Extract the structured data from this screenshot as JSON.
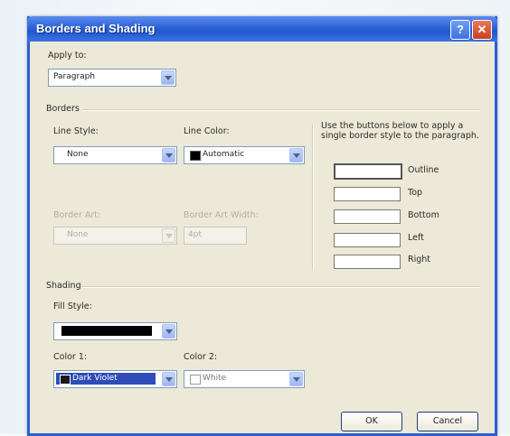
{
  "dialog": {
    "title": "Borders and Shading",
    "help_glyph": "?",
    "close_glyph": "✕"
  },
  "apply_to": {
    "label": "Apply to:",
    "value": "Paragraph"
  },
  "borders": {
    "heading": "Borders",
    "line_style_label": "Line Style:",
    "line_style_value": "None",
    "line_color_label": "Line Color:",
    "line_color_value": "Automatic",
    "border_art_label": "Border Art:",
    "border_art_value": "None",
    "border_art_width_label": "Border Art Width:",
    "border_art_width_value": "4pt",
    "instructions": "Use the buttons below to apply a single border style to the paragraph.",
    "buttons": [
      "Outline",
      "Top",
      "Bottom",
      "Left",
      "Right"
    ]
  },
  "shading": {
    "heading": "Shading",
    "fill_style_label": "Fill Style:",
    "color1_label": "Color 1:",
    "color1_value": "Dark Violet",
    "color2_label": "Color 2:",
    "color2_value": "White"
  },
  "footer": {
    "ok_label": "OK",
    "cancel_label": "Cancel"
  },
  "colors": {
    "titlebar": "#2d63d8",
    "dialog_bg": "#ece9d8",
    "selection": "#2f4cb8"
  }
}
